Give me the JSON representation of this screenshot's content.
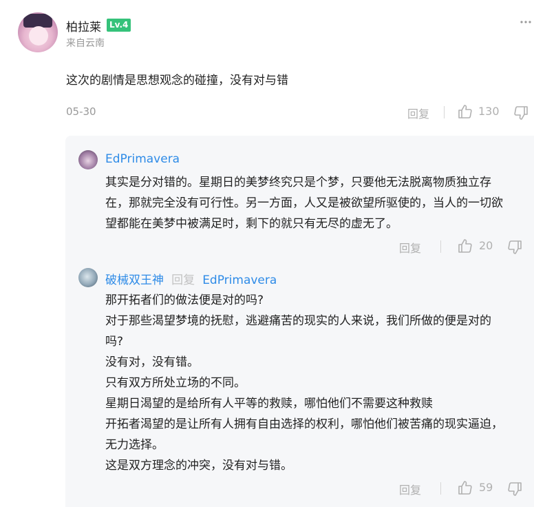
{
  "post": {
    "username": "柏拉莱",
    "level": "Lv.4",
    "location": "来自云南",
    "text": "这次的剧情是思想观念的碰撞，没有对与错",
    "date": "05-30",
    "reply_label": "回复",
    "likes": "130"
  },
  "replies": [
    {
      "username": "EdPrimavera",
      "lines": [
        "其实是分对错的。星期日的美梦终究只是个梦，只要他无法脱离物质独立存",
        "在，那就完全没有可行性。另一方面，人又是被欲望所驱使的，当人的一切欲",
        "望都能在美梦中被满足时，剩下的就只有无尽的虚无了。"
      ],
      "reply_label": "回复",
      "likes": "20"
    },
    {
      "username": "破械双王神",
      "reply_word": "回复",
      "reply_to": "EdPrimavera",
      "lines": [
        "那开拓者们的做法便是对的吗?",
        "对于那些渴望梦境的抚慰，逃避痛苦的现实的人来说，我们所做的便是对的",
        "吗?",
        "没有对，没有错。",
        "只有双方所处立场的不同。",
        "星期日渴望的是给所有人平等的救赎，哪怕他们不需要这种救赎",
        "开拓者渴望的是让所有人拥有自由选择的权利，哪怕他们被苦痛的现实逼迫，",
        "无力选择。",
        "这是双方理念的冲突，没有对与错。"
      ],
      "reply_label": "回复",
      "likes": "59"
    }
  ],
  "colors": {
    "accent_blue": "#2e8be7",
    "level_green": "#35c27a",
    "muted_gray": "#b0b0b0",
    "reply_bg": "#f6f7f9"
  },
  "icons": {
    "like": "thumb-up-icon",
    "dislike": "thumb-down-icon",
    "more": "more-dots-icon"
  }
}
